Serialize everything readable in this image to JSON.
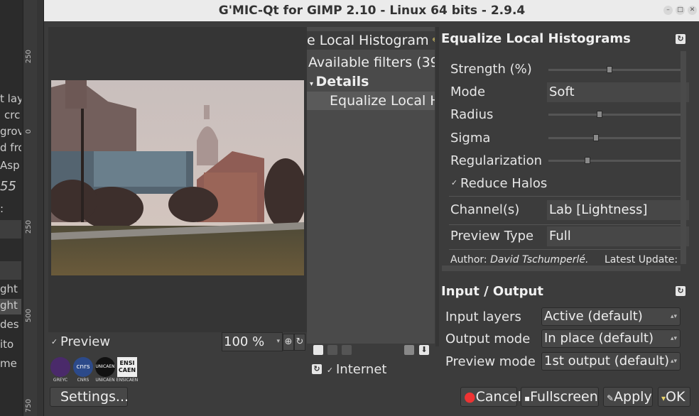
{
  "window": {
    "title": "G'MIC-Qt for GIMP 2.10 - Linux 64 bits - 2.9.4"
  },
  "background_app": {
    "tool_labels": [
      "t lay",
      "crc",
      "grov",
      "d fro",
      "Asp",
      "55",
      ":",
      "ght",
      "ght",
      "des",
      "ito",
      "me"
    ],
    "ruler_marks": [
      "250",
      "0",
      "250",
      "500",
      "750"
    ]
  },
  "preview": {
    "checkbox_label": "Preview",
    "zoom_value": "100 %",
    "logos": [
      "GREYC",
      "CNRS",
      "UNICAEN",
      "ENSICAEN"
    ],
    "logo_texts": [
      "cnrs",
      "UNICAEN",
      "ENSI CAEN"
    ],
    "settings_label": "Settings..."
  },
  "filter_tree": {
    "search_text": "e Local Histogram",
    "available": "Available filters (39",
    "category": "Details",
    "item": "Equalize Local H",
    "internet_label": "Internet"
  },
  "filter_params": {
    "title": "Equalize Local Histograms",
    "params": [
      {
        "label": "Strength (%)",
        "type": "slider",
        "value": 0.45
      },
      {
        "label": "Mode",
        "type": "combo",
        "value": "Soft"
      },
      {
        "label": "Radius",
        "type": "slider",
        "value": 0.38
      },
      {
        "label": "Sigma",
        "type": "slider",
        "value": 0.35
      },
      {
        "label": "Regularization",
        "type": "slider",
        "value": 0.29
      }
    ],
    "reduce_halos": "Reduce Halos",
    "channels_label": "Channel(s)",
    "channels_value": "Lab [Lightness]",
    "preview_type_label": "Preview Type",
    "preview_type_value": "Full",
    "author_prefix": "Author:",
    "author_name": "David Tschumperlé.",
    "latest_update": "Latest Update:"
  },
  "io": {
    "title": "Input / Output",
    "rows": [
      {
        "label": "Input layers",
        "value": "Active (default)"
      },
      {
        "label": "Output mode",
        "value": "In place (default)"
      },
      {
        "label": "Preview mode",
        "value": "1st output (default)"
      }
    ]
  },
  "buttons": {
    "cancel": "Cancel",
    "fullscreen": "Fullscreen",
    "apply": "Apply",
    "ok": "OK"
  },
  "colors": {
    "window_bg": "#3c3c3c",
    "titlebar": "#ebebeb",
    "tree_bg": "#4a4a4a",
    "selected": "#5a5a5a"
  }
}
